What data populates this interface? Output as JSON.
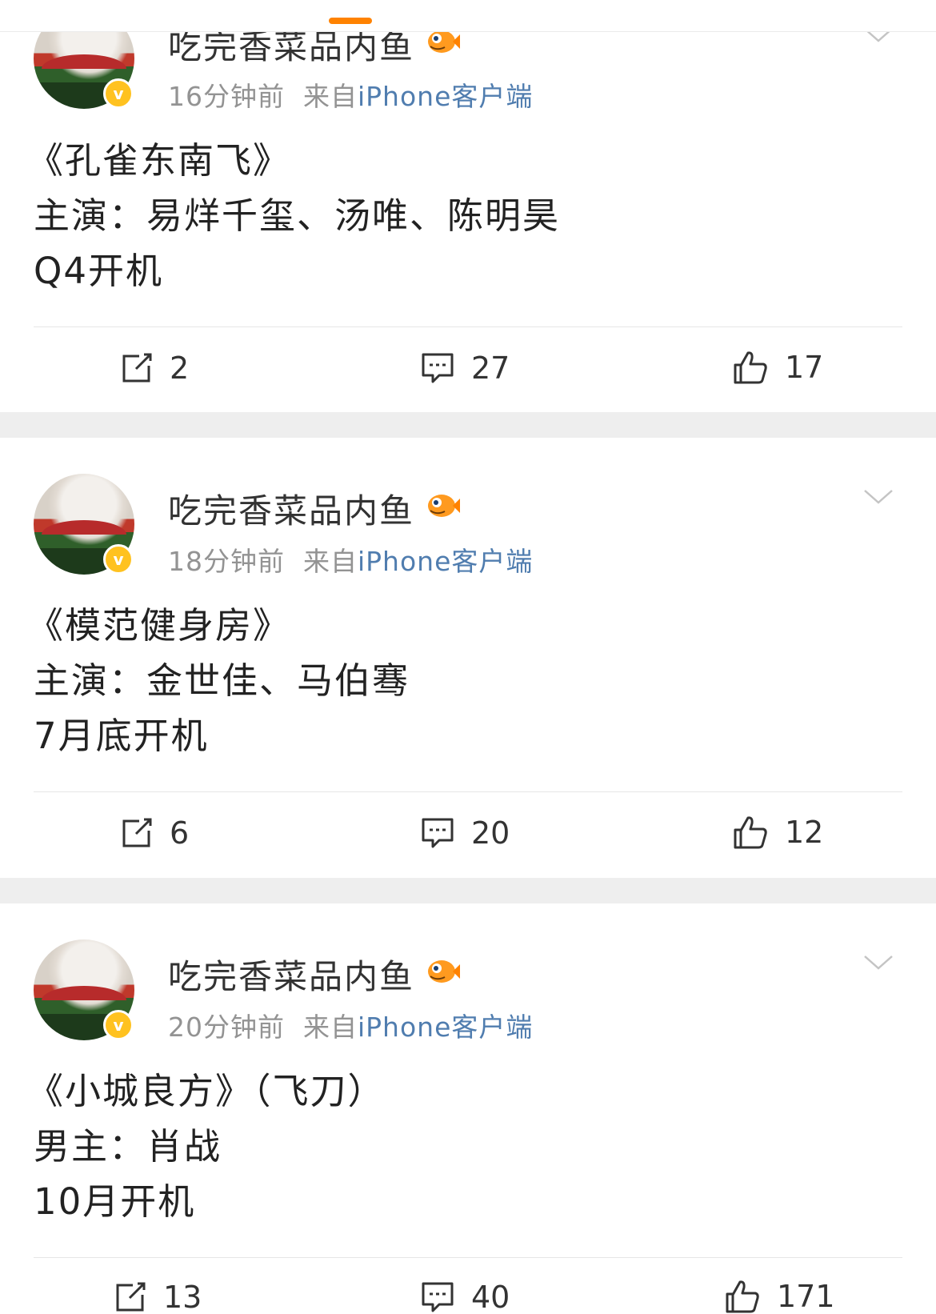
{
  "posts": [
    {
      "username": "吃完香菜品内鱼",
      "time": "16分钟前",
      "source_prefix": "来自",
      "client": "iPhone客户端",
      "lines": [
        "《孔雀东南飞》",
        "主演：易烊千玺、汤唯、陈明昊",
        "Q4开机"
      ],
      "repost_count": "2",
      "comment_count": "27",
      "like_count": "17"
    },
    {
      "username": "吃完香菜品内鱼",
      "time": "18分钟前",
      "source_prefix": "来自",
      "client": "iPhone客户端",
      "lines": [
        "《模范健身房》",
        "主演：金世佳、马伯骞",
        "7月底开机"
      ],
      "repost_count": "6",
      "comment_count": "20",
      "like_count": "12"
    },
    {
      "username": "吃完香菜品内鱼",
      "time": "20分钟前",
      "source_prefix": "来自",
      "client": "iPhone客户端",
      "lines": [
        "《小城良方》（飞刀）",
        "男主：肖战",
        "10月开机"
      ],
      "repost_count": "13",
      "comment_count": "40",
      "like_count": "171"
    }
  ],
  "icons": {
    "verified_badge": "v-badge-icon",
    "member_badge": "fish-icon",
    "repost": "repost-icon",
    "comment": "comment-icon",
    "like": "thumbs-up-icon",
    "more": "chevron-down-icon"
  },
  "colors": {
    "accent": "#ff8200",
    "link": "#507daf",
    "meta": "#939393",
    "badge": "#ffc220",
    "separator": "#eeeeee"
  }
}
